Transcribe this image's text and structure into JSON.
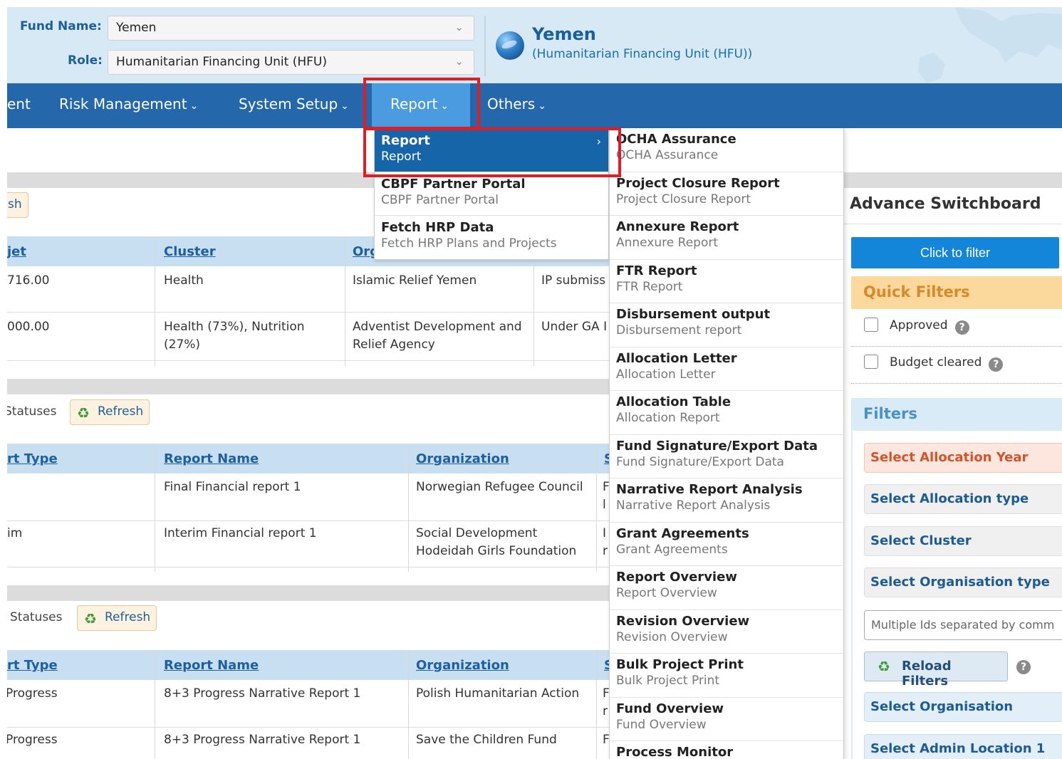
{
  "header": {
    "fund_label": "Fund Name:",
    "fund_value": "Yemen",
    "role_label": "Role:",
    "role_value": "Humanitarian Financing Unit (HFU)",
    "title": "Yemen",
    "subtitle": "(Humanitarian Financing Unit (HFU))"
  },
  "nav": {
    "items": [
      "ent",
      "Risk Management",
      "System Setup",
      "Report",
      "Others"
    ],
    "caret": "⌄"
  },
  "menu1": {
    "items": [
      {
        "title": "Report",
        "sub": "Report"
      },
      {
        "title": "CBPF Partner Portal",
        "sub": "CBPF Partner Portal"
      },
      {
        "title": "Fetch HRP Data",
        "sub": "Fetch HRP Plans and Projects"
      }
    ],
    "arrow": "›"
  },
  "menu2": {
    "items": [
      {
        "title": "OCHA Assurance",
        "sub": "OCHA Assurance"
      },
      {
        "title": "Project Closure Report",
        "sub": "Project Closure Report"
      },
      {
        "title": "Annexure Report",
        "sub": "Annexure Report"
      },
      {
        "title": "FTR Report",
        "sub": "FTR Report"
      },
      {
        "title": "Disbursement output",
        "sub": "Disbursement report"
      },
      {
        "title": "Allocation Letter",
        "sub": "Allocation Letter"
      },
      {
        "title": "Allocation Table",
        "sub": "Allocation Report"
      },
      {
        "title": "Fund Signature/Export Data",
        "sub": "Fund Signature/Export Data"
      },
      {
        "title": "Narrative Report Analysis",
        "sub": "Narrative Report Analysis"
      },
      {
        "title": "Grant Agreements",
        "sub": "Grant Agreements"
      },
      {
        "title": "Report Overview",
        "sub": "Report Overview"
      },
      {
        "title": "Revision Overview",
        "sub": "Revision Overview"
      },
      {
        "title": "Bulk Project Print",
        "sub": "Bulk Project Print"
      },
      {
        "title": "Fund Overview",
        "sub": "Fund Overview"
      },
      {
        "title": "Process Monitor",
        "sub": ""
      }
    ]
  },
  "grid1": {
    "partial_btn": "sh",
    "headers": [
      "jet",
      "Cluster",
      "Org"
    ],
    "rows": [
      {
        "budget": "716.00",
        "cluster": "Health",
        "org": "Islamic Relief Yemen",
        "status": "IP submiss"
      },
      {
        "budget": "000.00",
        "cluster_l1": "Health (73%), Nutrition",
        "cluster_l2": "(27%)",
        "org_l1": "Adventist Development and",
        "org_l2": "Relief Agency",
        "status": "Under GA I"
      }
    ]
  },
  "grid2": {
    "status_label": "Statuses",
    "refresh": "Refresh",
    "headers": [
      "rt Type",
      "Report Name",
      "Organization",
      "S"
    ],
    "rows": [
      {
        "type": "",
        "name": "Final Financial report 1",
        "org": "Norwegian Refugee Council",
        "extra1": "F",
        "extra2": "l"
      },
      {
        "type": "im",
        "name": "Interim Financial report 1",
        "org_l1": "Social Development",
        "org_l2": "Hodeidah Girls Foundation",
        "extra1": "I",
        "extra2": "r"
      }
    ]
  },
  "grid3": {
    "status_label": "Statuses",
    "refresh": "Refresh",
    "headers": [
      "rt Type",
      "Report Name",
      "Organization",
      "S"
    ],
    "rows": [
      {
        "type": "Progress",
        "name": "8+3 Progress Narrative Report 1",
        "org": "Polish Humanitarian Action",
        "extra1": "F",
        "extra2": "r"
      },
      {
        "type": "Progress",
        "name": "8+3 Progress Narrative Report 1",
        "org": "Save the Children Fund",
        "extra1": "F",
        "extra2": ""
      }
    ]
  },
  "sidebar": {
    "title": "Advance Switchboard",
    "click_filter": "Click to filter",
    "quick_filters": "Quick Filters",
    "approved": "Approved",
    "budget_cleared": "Budget cleared",
    "filters": "Filters",
    "selects": [
      "Select Allocation Year",
      "Select Allocation type",
      "Select Cluster",
      "Select Organisation type"
    ],
    "ids_placeholder": "Multiple Ids separated by comm",
    "reload": "Reload Filters",
    "more_selects": [
      "Select Organisation",
      "Select Admin Location 1"
    ]
  },
  "icons": {
    "help": "?",
    "refresh": "♻",
    "chevron": "⌄"
  },
  "colors": {
    "nav": "#2467aa",
    "active_tab": "#4b9be0",
    "highlight": "#e01c24",
    "menu_active": "#1565a8",
    "primary_btn": "#1486d9",
    "quick_filters_bg": "#fbd89b",
    "filters_bg": "#d9ebf7"
  }
}
